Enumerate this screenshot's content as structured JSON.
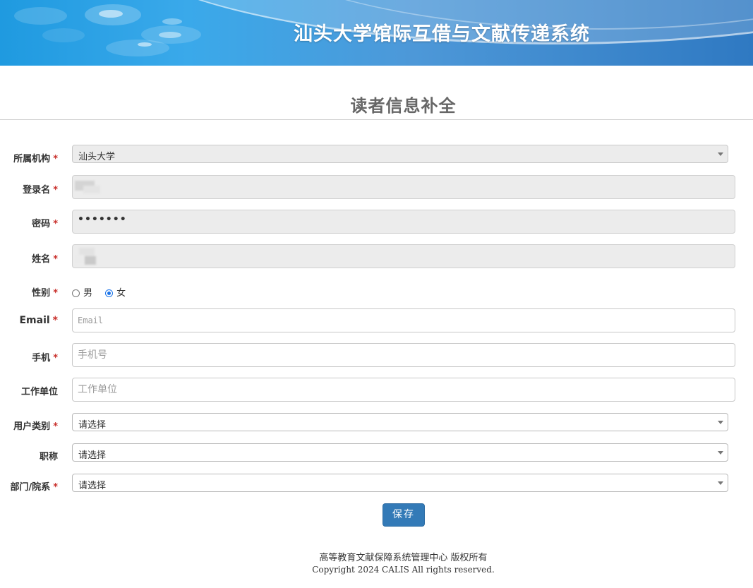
{
  "banner": {
    "title": "汕头大学馆际互借与文献传递系统"
  },
  "page": {
    "heading": "读者信息补全"
  },
  "form": {
    "required_mark": "*",
    "institution": {
      "label": "所属机构",
      "value": "汕头大学"
    },
    "login_name": {
      "label": "登录名"
    },
    "password": {
      "label": "密码",
      "masked_value": "•••••••"
    },
    "name": {
      "label": "姓名"
    },
    "gender": {
      "label": "性别",
      "options": [
        "男",
        "女"
      ],
      "selected": "女"
    },
    "email": {
      "label": "Email",
      "placeholder": "Email"
    },
    "mobile": {
      "label": "手机",
      "placeholder": "手机号"
    },
    "work_unit": {
      "label": "工作单位",
      "placeholder": "工作单位"
    },
    "user_type": {
      "label": "用户类别",
      "value": "请选择"
    },
    "title": {
      "label": "职称",
      "value": "请选择"
    },
    "department": {
      "label": "部门/院系",
      "value": "请选择"
    },
    "save_label": "保存"
  },
  "footer": {
    "line1": "高等教育文献保障系统管理中心 版权所有",
    "line2": "Copyright 2024 CALIS All rights reserved."
  }
}
